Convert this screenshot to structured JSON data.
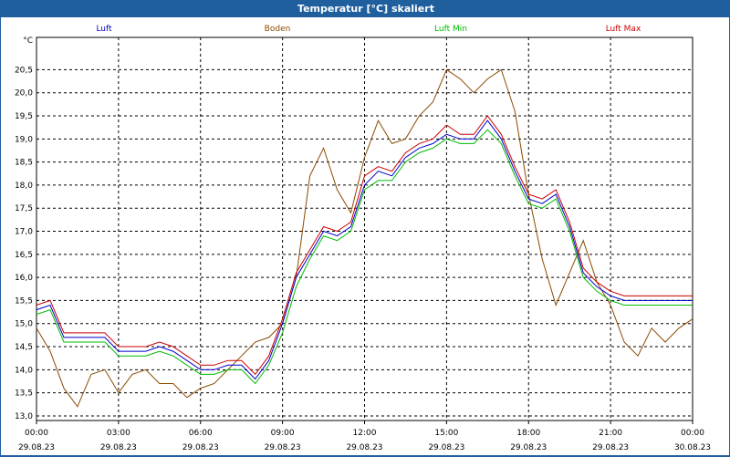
{
  "window": {
    "title": "Temperatur [°C] skaliert"
  },
  "chart_data": {
    "type": "line",
    "title": "Temperatur [°C] skaliert",
    "ylabel": "°C",
    "xlabel": "",
    "ylim": [
      12.9,
      21.2
    ],
    "yticks": [
      13.0,
      13.5,
      14.0,
      14.5,
      15.0,
      15.5,
      16.0,
      16.5,
      17.0,
      17.5,
      18.0,
      18.5,
      19.0,
      19.5,
      20.0,
      20.5
    ],
    "ytick_labels": [
      "13,0",
      "13,5",
      "14,0",
      "14,5",
      "15,0",
      "15,5",
      "16,0",
      "16,5",
      "17,0",
      "17,5",
      "18,0",
      "18,5",
      "19,0",
      "19,5",
      "20,0",
      "20,5"
    ],
    "xlim": [
      0,
      24
    ],
    "xticks": [
      0,
      3,
      6,
      9,
      12,
      15,
      18,
      21,
      24
    ],
    "xtick_time": [
      "00:00",
      "03:00",
      "06:00",
      "09:00",
      "12:00",
      "15:00",
      "18:00",
      "21:00",
      "00:00"
    ],
    "xtick_date": [
      "29.08.23",
      "29.08.23",
      "29.08.23",
      "29.08.23",
      "29.08.23",
      "29.08.23",
      "29.08.23",
      "29.08.23",
      "30.08.23"
    ],
    "grid": true,
    "legend_position": "top",
    "series": [
      {
        "name": "Luft",
        "color": "#0000cc",
        "x": [
          0,
          0.5,
          1,
          1.5,
          2,
          2.5,
          3,
          3.5,
          4,
          4.5,
          5,
          5.5,
          6,
          6.5,
          7,
          7.5,
          8,
          8.5,
          9,
          9.5,
          10,
          10.5,
          11,
          11.5,
          12,
          12.5,
          13,
          13.5,
          14,
          14.5,
          15,
          15.5,
          16,
          16.5,
          17,
          17.5,
          18,
          18.5,
          19,
          19.5,
          20,
          20.5,
          21,
          21.5,
          22,
          22.5,
          23,
          23.5,
          24
        ],
        "values": [
          15.3,
          15.4,
          14.7,
          14.7,
          14.7,
          14.7,
          14.4,
          14.4,
          14.4,
          14.5,
          14.4,
          14.2,
          14.0,
          14.0,
          14.1,
          14.1,
          13.8,
          14.2,
          15.0,
          16.0,
          16.5,
          17.0,
          16.9,
          17.1,
          18.0,
          18.3,
          18.2,
          18.6,
          18.8,
          18.9,
          19.1,
          19.0,
          19.0,
          19.4,
          19.0,
          18.3,
          17.7,
          17.6,
          17.8,
          17.1,
          16.1,
          15.8,
          15.6,
          15.5,
          15.5,
          15.5,
          15.5,
          15.5,
          15.5
        ]
      },
      {
        "name": "Boden",
        "color": "#8b4a00",
        "x": [
          0,
          0.5,
          1,
          1.5,
          2,
          2.5,
          3,
          3.5,
          4,
          4.5,
          5,
          5.5,
          6,
          6.5,
          7,
          7.5,
          8,
          8.5,
          9,
          9.5,
          10,
          10.5,
          11,
          11.5,
          12,
          12.5,
          13,
          13.5,
          14,
          14.5,
          15,
          15.5,
          16,
          16.5,
          17,
          17.5,
          18,
          18.5,
          19,
          19.5,
          20,
          20.5,
          21,
          21.5,
          22,
          22.5,
          23,
          23.5,
          24
        ],
        "values": [
          14.9,
          14.4,
          13.6,
          13.2,
          13.9,
          14.0,
          13.5,
          13.9,
          14.0,
          13.7,
          13.7,
          13.4,
          13.6,
          13.7,
          14.0,
          14.3,
          14.6,
          14.7,
          15.0,
          16.0,
          18.2,
          18.8,
          17.9,
          17.4,
          18.6,
          19.4,
          18.9,
          19.0,
          19.5,
          19.8,
          20.5,
          20.3,
          20.0,
          20.3,
          20.5,
          19.6,
          17.8,
          16.4,
          15.4,
          16.1,
          16.8,
          15.9,
          15.4,
          14.6,
          14.3,
          14.9,
          14.6,
          14.9,
          15.1
        ]
      },
      {
        "name": "Luft Min",
        "color": "#00bb00",
        "x": [
          0,
          0.5,
          1,
          1.5,
          2,
          2.5,
          3,
          3.5,
          4,
          4.5,
          5,
          5.5,
          6,
          6.5,
          7,
          7.5,
          8,
          8.5,
          9,
          9.5,
          10,
          10.5,
          11,
          11.5,
          12,
          12.5,
          13,
          13.5,
          14,
          14.5,
          15,
          15.5,
          16,
          16.5,
          17,
          17.5,
          18,
          18.5,
          19,
          19.5,
          20,
          20.5,
          21,
          21.5,
          22,
          22.5,
          23,
          23.5,
          24
        ],
        "values": [
          15.2,
          15.3,
          14.6,
          14.6,
          14.6,
          14.6,
          14.3,
          14.3,
          14.3,
          14.4,
          14.3,
          14.1,
          13.9,
          13.9,
          14.0,
          14.0,
          13.7,
          14.1,
          14.8,
          15.8,
          16.4,
          16.9,
          16.8,
          17.0,
          17.9,
          18.1,
          18.1,
          18.5,
          18.7,
          18.8,
          19.0,
          18.9,
          18.9,
          19.2,
          18.9,
          18.2,
          17.6,
          17.5,
          17.7,
          17.0,
          16.0,
          15.7,
          15.5,
          15.4,
          15.4,
          15.4,
          15.4,
          15.4,
          15.4
        ]
      },
      {
        "name": "Luft Max",
        "color": "#cc0000",
        "x": [
          0,
          0.5,
          1,
          1.5,
          2,
          2.5,
          3,
          3.5,
          4,
          4.5,
          5,
          5.5,
          6,
          6.5,
          7,
          7.5,
          8,
          8.5,
          9,
          9.5,
          10,
          10.5,
          11,
          11.5,
          12,
          12.5,
          13,
          13.5,
          14,
          14.5,
          15,
          15.5,
          16,
          16.5,
          17,
          17.5,
          18,
          18.5,
          19,
          19.5,
          20,
          20.5,
          21,
          21.5,
          22,
          22.5,
          23,
          23.5,
          24
        ],
        "values": [
          15.4,
          15.5,
          14.8,
          14.8,
          14.8,
          14.8,
          14.5,
          14.5,
          14.5,
          14.6,
          14.5,
          14.3,
          14.1,
          14.1,
          14.2,
          14.2,
          13.9,
          14.3,
          15.1,
          16.1,
          16.6,
          17.1,
          17.0,
          17.2,
          18.2,
          18.4,
          18.3,
          18.7,
          18.9,
          19.0,
          19.3,
          19.1,
          19.1,
          19.5,
          19.1,
          18.4,
          17.8,
          17.7,
          17.9,
          17.2,
          16.2,
          15.9,
          15.7,
          15.6,
          15.6,
          15.6,
          15.6,
          15.6,
          15.6
        ]
      }
    ]
  }
}
